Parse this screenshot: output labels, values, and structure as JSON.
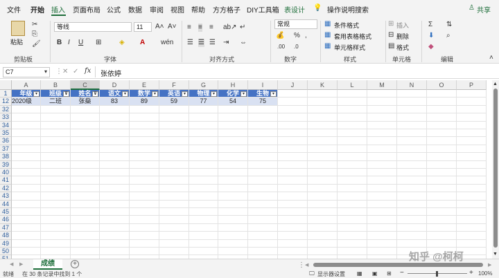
{
  "menu": {
    "tabs": [
      "文件",
      "开始",
      "插入",
      "页面布局",
      "公式",
      "数据",
      "审阅",
      "视图",
      "帮助",
      "方方格子",
      "DIY工具箱",
      "表设计"
    ],
    "active_tab": "插入",
    "search": "操作说明搜索",
    "share": "共享"
  },
  "ribbon": {
    "paste": "粘贴",
    "clipboard_label": "剪贴板",
    "font_name": "等线",
    "font_size": "11",
    "font_label": "字体",
    "align_label": "对齐方式",
    "number_format": "常规",
    "number_label": "数字",
    "cond_format": "条件格式",
    "table_format": "套用表格格式",
    "cell_style": "单元格样式",
    "style_label": "样式",
    "insert": "插入",
    "delete": "删除",
    "format": "格式",
    "cells_label": "单元格",
    "edit_label": "编辑"
  },
  "formula_bar": {
    "name_box": "C7",
    "fx": "fx",
    "content": "张依婷"
  },
  "grid": {
    "columns": [
      "A",
      "B",
      "C",
      "D",
      "E",
      "F",
      "G",
      "H",
      "I",
      "J",
      "K",
      "L",
      "M",
      "N",
      "O",
      "P"
    ],
    "headers": [
      "年级",
      "班级",
      "姓名",
      "语文",
      "数学",
      "英语",
      "物理",
      "化学",
      "生物"
    ],
    "data_row": [
      "2020级",
      "二班",
      "张燊",
      "83",
      "89",
      "59",
      "77",
      "54",
      "75"
    ],
    "row_numbers": [
      "1",
      "12",
      "32",
      "33",
      "34",
      "35",
      "36",
      "37",
      "38",
      "39",
      "40",
      "41",
      "42",
      "43",
      "44",
      "45",
      "46",
      "47",
      "48",
      "49",
      "50",
      "51"
    ]
  },
  "sheet": {
    "tab": "成绩",
    "add": "+",
    "watermark": "知乎 @柯柯"
  },
  "status": {
    "ready": "就绪",
    "filter_msg": "在 30 条记录中找到 1 个",
    "display": "显示器设置",
    "zoom": "100%"
  },
  "colors": {
    "header_fill": "#4472c4",
    "row_fill": "#d9e1f2",
    "accent": "#1e6e3a"
  }
}
